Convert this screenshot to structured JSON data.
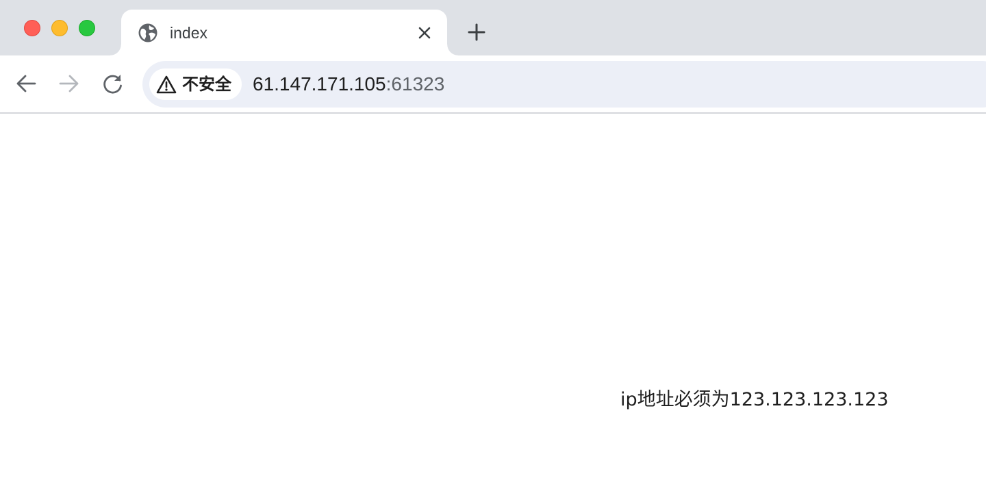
{
  "tab": {
    "title": "index",
    "favicon": "globe-icon"
  },
  "address_bar": {
    "security_label": "不安全",
    "host": "61.147.171.105",
    "port_suffix": ":61323"
  },
  "page": {
    "message": "ip地址必须为123.123.123.123"
  },
  "colors": {
    "tabstrip_bg": "#dee1e6",
    "omnibox_bg": "#eceff7",
    "traffic_red": "#ff5f57",
    "traffic_yellow": "#febc2e",
    "traffic_green": "#28c840"
  }
}
